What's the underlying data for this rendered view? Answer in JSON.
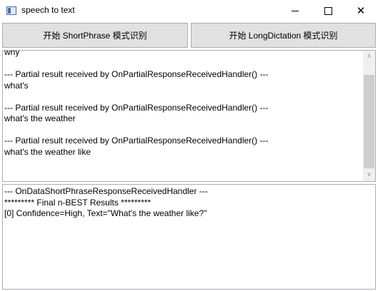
{
  "window": {
    "title": "speech to text"
  },
  "titlebar_controls": {
    "minimize_icon": "minimize-icon",
    "maximize_icon": "maximize-icon",
    "close_icon": "close-icon",
    "close_glyph": "✕"
  },
  "buttons": {
    "short_phrase": "开始 ShortPhrase 模式识别",
    "long_dictation": "开始 LongDictation 模式识别"
  },
  "partial_log": {
    "lines": [
      "why",
      "",
      "--- Partial result received by OnPartialResponseReceivedHandler() ---",
      "what's",
      "",
      "--- Partial result received by OnPartialResponseReceivedHandler() ---",
      "what's the weather",
      "",
      "--- Partial result received by OnPartialResponseReceivedHandler() ---",
      "what's the weather like"
    ],
    "scroll_position": 0.2
  },
  "final_log": {
    "lines": [
      "--- OnDataShortPhraseResponseReceivedHandler ---",
      "********* Final n-BEST Results *********",
      "[0] Confidence=High, Text=\"What's the weather like?\""
    ]
  },
  "scrollbar": {
    "up_glyph": "∧",
    "down_glyph": "∨"
  }
}
